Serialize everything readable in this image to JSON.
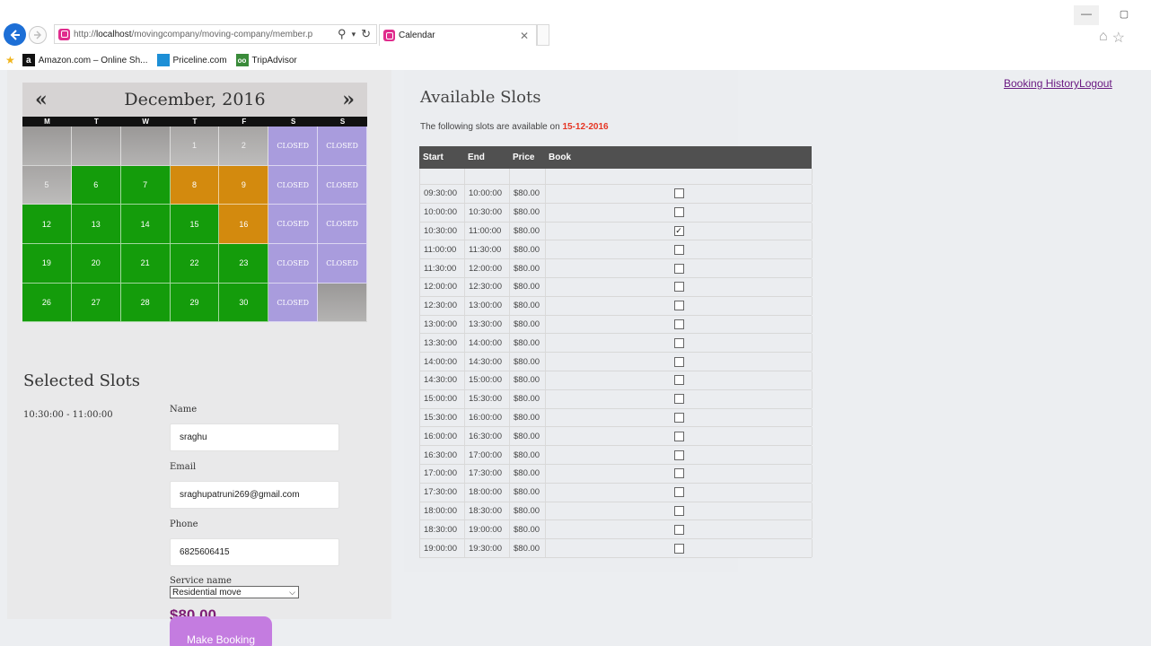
{
  "browser": {
    "url_prefix": "http://",
    "url_host": "localhost",
    "url_path": "/movingcompany/moving-company/member.p",
    "tab_title": "Calendar",
    "favorites": [
      {
        "label": "Amazon.com – Online Sh...",
        "icon": "amazon-icon"
      },
      {
        "label": "Priceline.com",
        "icon": "priceline-icon"
      },
      {
        "label": "TripAdvisor",
        "icon": "tripadvisor-icon"
      }
    ]
  },
  "nav": {
    "booking_history": "Booking History",
    "logout": "Logout"
  },
  "calendar": {
    "title": "December, 2016",
    "prev": "«",
    "next": "»",
    "weekdays": [
      "M",
      "T",
      "W",
      "T",
      "F",
      "S",
      "S"
    ],
    "cells": [
      {
        "label": "",
        "status": "empty"
      },
      {
        "label": "",
        "status": "empty"
      },
      {
        "label": "",
        "status": "empty"
      },
      {
        "label": "1",
        "status": "past"
      },
      {
        "label": "2",
        "status": "past"
      },
      {
        "label": "CLOSED",
        "status": "closed"
      },
      {
        "label": "CLOSED",
        "status": "closed"
      },
      {
        "label": "5",
        "status": "past"
      },
      {
        "label": "6",
        "status": "open"
      },
      {
        "label": "7",
        "status": "open"
      },
      {
        "label": "8",
        "status": "partial"
      },
      {
        "label": "9",
        "status": "partial"
      },
      {
        "label": "CLOSED",
        "status": "closed"
      },
      {
        "label": "CLOSED",
        "status": "closed"
      },
      {
        "label": "12",
        "status": "open"
      },
      {
        "label": "13",
        "status": "open"
      },
      {
        "label": "14",
        "status": "open"
      },
      {
        "label": "15",
        "status": "open"
      },
      {
        "label": "16",
        "status": "partial"
      },
      {
        "label": "CLOSED",
        "status": "closed"
      },
      {
        "label": "CLOSED",
        "status": "closed"
      },
      {
        "label": "19",
        "status": "open"
      },
      {
        "label": "20",
        "status": "open"
      },
      {
        "label": "21",
        "status": "open"
      },
      {
        "label": "22",
        "status": "open"
      },
      {
        "label": "23",
        "status": "open"
      },
      {
        "label": "CLOSED",
        "status": "closed"
      },
      {
        "label": "CLOSED",
        "status": "closed"
      },
      {
        "label": "26",
        "status": "open"
      },
      {
        "label": "27",
        "status": "open"
      },
      {
        "label": "28",
        "status": "open"
      },
      {
        "label": "29",
        "status": "open"
      },
      {
        "label": "30",
        "status": "open"
      },
      {
        "label": "CLOSED",
        "status": "closed"
      },
      {
        "label": "",
        "status": "empty"
      }
    ],
    "colors": {
      "open": "#149c0b",
      "partial": "#d38a0e",
      "closed": "#a99cdd",
      "past": "#b0aeac"
    }
  },
  "selected": {
    "title": "Selected Slots",
    "slot": "10:30:00 - 11:00:00",
    "name_label": "Name",
    "name_value": "sraghu",
    "email_label": "Email",
    "email_value": "sraghupatruni269@gmail.com",
    "phone_label": "Phone",
    "phone_value": "6825606415",
    "service_label": "Service name",
    "service_value": "Residential move",
    "price": "$80.00",
    "book_button": "Make Booking"
  },
  "available": {
    "title": "Available Slots",
    "desc_prefix": "The following slots are available on ",
    "date": "15-12-2016",
    "headers": [
      "Start",
      "End",
      "Price",
      "Book"
    ],
    "rows": [
      {
        "start": "09:30:00",
        "end": "10:00:00",
        "price": "$80.00",
        "checked": false
      },
      {
        "start": "10:00:00",
        "end": "10:30:00",
        "price": "$80.00",
        "checked": false
      },
      {
        "start": "10:30:00",
        "end": "11:00:00",
        "price": "$80.00",
        "checked": true
      },
      {
        "start": "11:00:00",
        "end": "11:30:00",
        "price": "$80.00",
        "checked": false
      },
      {
        "start": "11:30:00",
        "end": "12:00:00",
        "price": "$80.00",
        "checked": false
      },
      {
        "start": "12:00:00",
        "end": "12:30:00",
        "price": "$80.00",
        "checked": false
      },
      {
        "start": "12:30:00",
        "end": "13:00:00",
        "price": "$80.00",
        "checked": false
      },
      {
        "start": "13:00:00",
        "end": "13:30:00",
        "price": "$80.00",
        "checked": false
      },
      {
        "start": "13:30:00",
        "end": "14:00:00",
        "price": "$80.00",
        "checked": false
      },
      {
        "start": "14:00:00",
        "end": "14:30:00",
        "price": "$80.00",
        "checked": false
      },
      {
        "start": "14:30:00",
        "end": "15:00:00",
        "price": "$80.00",
        "checked": false
      },
      {
        "start": "15:00:00",
        "end": "15:30:00",
        "price": "$80.00",
        "checked": false
      },
      {
        "start": "15:30:00",
        "end": "16:00:00",
        "price": "$80.00",
        "checked": false
      },
      {
        "start": "16:00:00",
        "end": "16:30:00",
        "price": "$80.00",
        "checked": false
      },
      {
        "start": "16:30:00",
        "end": "17:00:00",
        "price": "$80.00",
        "checked": false
      },
      {
        "start": "17:00:00",
        "end": "17:30:00",
        "price": "$80.00",
        "checked": false
      },
      {
        "start": "17:30:00",
        "end": "18:00:00",
        "price": "$80.00",
        "checked": false
      },
      {
        "start": "18:00:00",
        "end": "18:30:00",
        "price": "$80.00",
        "checked": false
      },
      {
        "start": "18:30:00",
        "end": "19:00:00",
        "price": "$80.00",
        "checked": false
      },
      {
        "start": "19:00:00",
        "end": "19:30:00",
        "price": "$80.00",
        "checked": false
      }
    ]
  }
}
